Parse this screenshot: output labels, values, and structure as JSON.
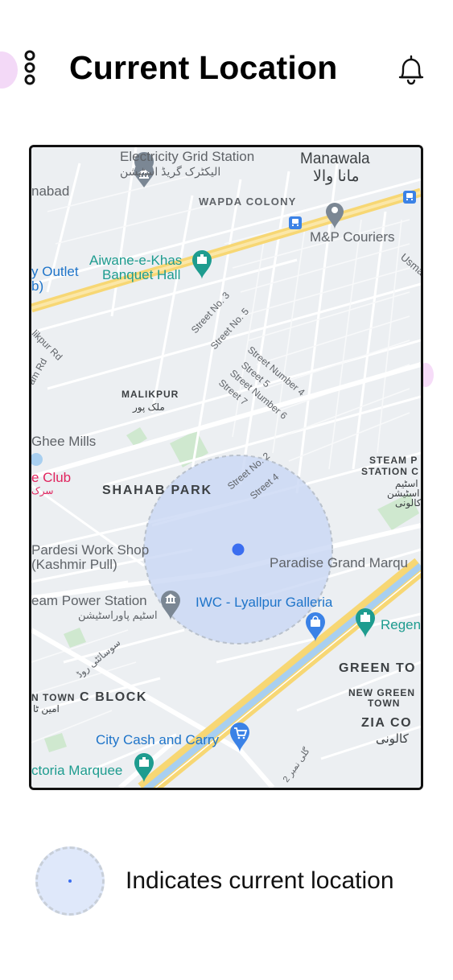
{
  "header": {
    "title": "Current Location",
    "menu_icon": "vertical-ellipsis-icon",
    "notification_icon": "bell-icon"
  },
  "colors": {
    "accent_location": "#3b6ef0",
    "location_radius_fill": "#c9d7f4",
    "poi_teal": "#1e9c8f",
    "poi_blue": "#3b82e6",
    "poi_gray": "#7b8794",
    "club_red": "#e0245e",
    "highway_yellow": "#f7d774"
  },
  "map": {
    "labels": {
      "electricity_grid_en": "Electricity Grid Station",
      "electricity_grid_ur": "الیکٹرک گریڈ اسٹیشن",
      "manawala_en": "Manawala",
      "manawala_ur": "مانا والا",
      "nabad": "nabad",
      "wapda_colony": "WAPDA COLONY",
      "mp_couriers": "M&P Couriers",
      "aiwane_1": "Aiwane-e-Khas",
      "aiwane_2": "Banquet Hall",
      "outlet_1": "y Outlet",
      "outlet_2": "b)",
      "usma": "Usma",
      "street_3": "Street No. 3",
      "street_5": "Street No. 5",
      "street_number_4": "Street Number 4",
      "street_5b": "Street 5",
      "street_number_6": "Street Number 6",
      "street_7": "Street 7",
      "malikpur_rd": "likpur Rd",
      "am_rd": "am Rd",
      "malikpur_en": "MALIKPUR",
      "malikpur_ur": "ملک پور",
      "ghee_mills": "Ghee Mills",
      "club": "e Club",
      "club_ur": "سرک",
      "shahab_park": "SHAHAB PARK",
      "street_no_2": "Street No. 2",
      "street_4": "Street 4",
      "steam_station_1": "STEAM P",
      "steam_station_2": "STATION C",
      "steam_station_ur_1": "اسٹیم",
      "steam_station_ur_2": "اسٹیشن",
      "steam_station_ur_3": "کالونی",
      "pardesi_1": "Pardesi Work Shop",
      "pardesi_2": "(Kashmir Pull)",
      "paradise": "Paradise Grand Marqu",
      "steam_power_en": "eam Power Station",
      "steam_power_ur": "اسٹیم پاوراسٹیشن",
      "iwc": "IWC - Lyallpur Galleria",
      "regen": "Regen",
      "green_town": "GREEN TO",
      "sosaiti_road": "سوسائٹی روڈ",
      "n_town": "N TOWN",
      "c_block": "C BLOCK",
      "amin_town_ur": "امین ٹا",
      "new_green_1": "NEW GREEN",
      "new_green_2": "TOWN",
      "zia_1": "ZIA CO",
      "zia_2": "کالونی",
      "city_cash": "City Cash and Carry",
      "victoria": "ctoria Marquee",
      "gali_2": "گلی نمبر 2"
    }
  },
  "legend": {
    "text": "Indicates current location"
  }
}
